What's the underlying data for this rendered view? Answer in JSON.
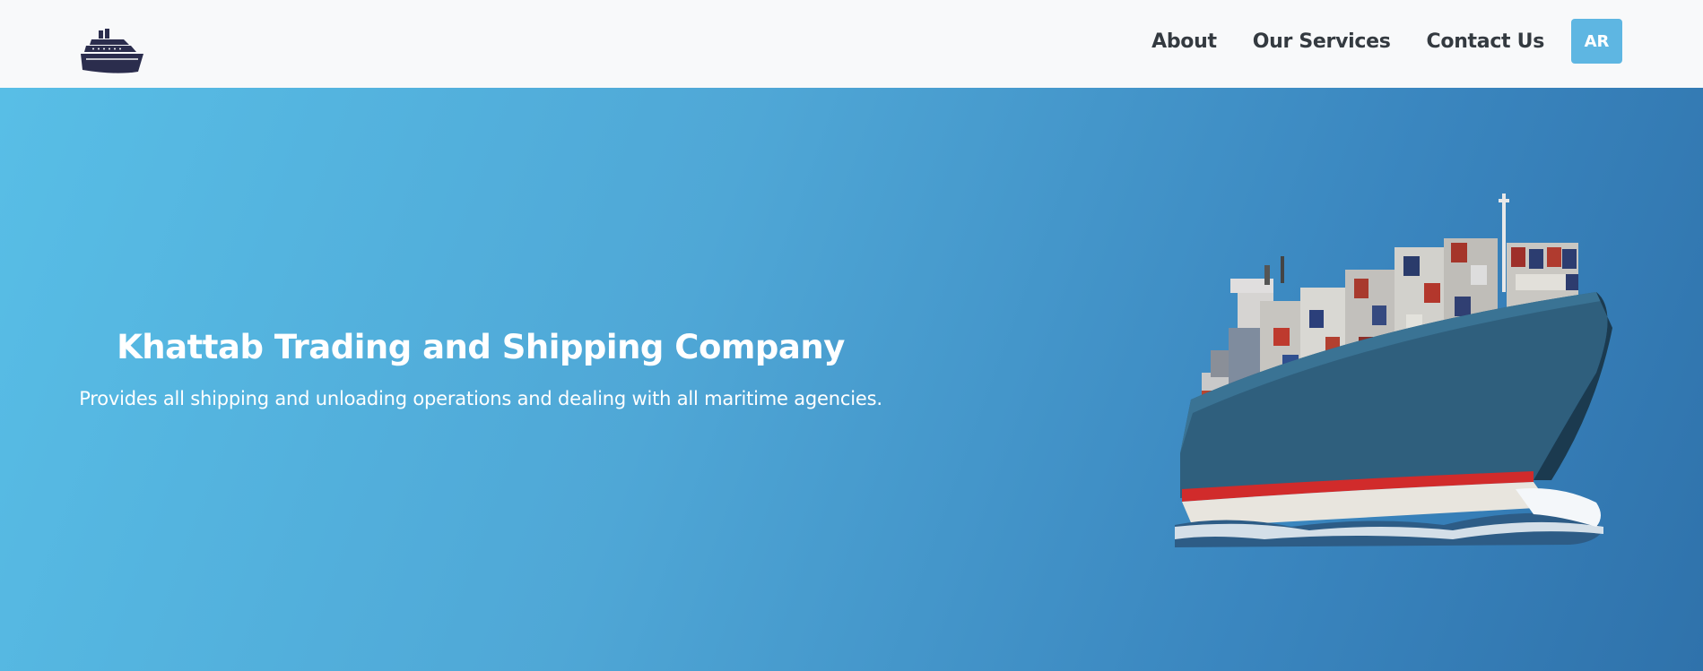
{
  "nav": {
    "logo_icon": "cruise-ship-icon",
    "links": [
      {
        "label": "About"
      },
      {
        "label": "Our Services"
      },
      {
        "label": "Contact Us"
      }
    ],
    "lang_button": "AR"
  },
  "hero": {
    "title": "Khattab Trading and Shipping Company",
    "subtitle": "Provides all shipping and unloading operations and dealing with all maritime agencies.",
    "image_icon": "container-ship-image"
  },
  "colors": {
    "navbar_bg": "#f8f9fa",
    "nav_text": "#343a40",
    "accent": "#5eb6e2",
    "hero_gradient_start": "#58bee6",
    "hero_gradient_end": "#2f72ab",
    "logo": "#2b2d4d"
  }
}
